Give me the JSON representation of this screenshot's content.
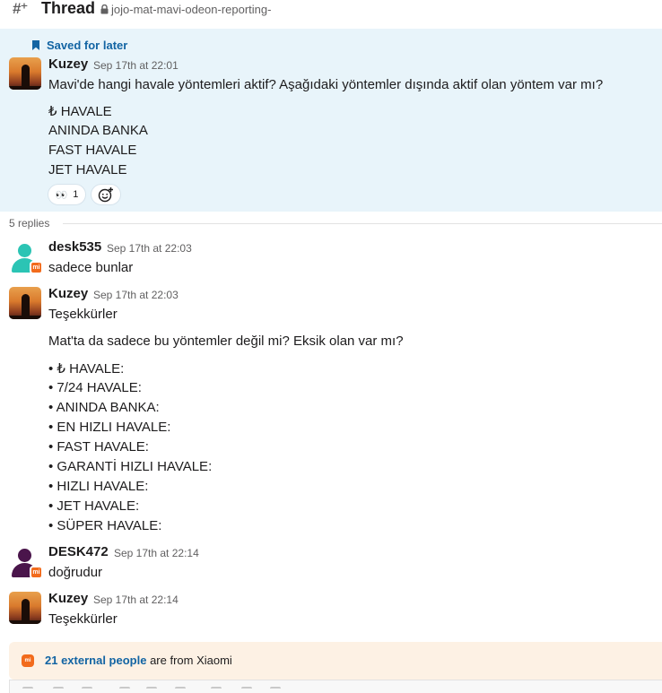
{
  "header": {
    "title": "Thread",
    "channel": "jojo-mat-mavi-odeon-reporting-"
  },
  "parent": {
    "saved_label": "Saved for later",
    "author": "Kuzey",
    "time": "Sep 17th at 22:01",
    "lines": [
      "Mavi'de hangi havale yöntemleri aktif? Aşağıdaki yöntemler dışında aktif olan yöntem var mı?",
      "₺ HAVALE",
      "ANINDA BANKA",
      "FAST HAVALE",
      "JET HAVALE"
    ],
    "reaction": {
      "emoji": "👀",
      "count": "1"
    }
  },
  "replies_label": "5 replies",
  "replies": [
    {
      "author": "desk535",
      "time": "Sep 17th at 22:03",
      "lines": [
        "sadece bunlar"
      ]
    },
    {
      "author": "Kuzey",
      "time": "Sep 17th at 22:03",
      "lines": [
        "Teşekkürler",
        "Mat'ta da sadece bu yöntemler değil mi? Eksik olan var mı?",
        "• ₺ HAVALE:",
        "• 7/24 HAVALE:",
        "• ANINDA BANKA:",
        "• EN HIZLI HAVALE:",
        "• FAST HAVALE:",
        "• GARANTİ HIZLI HAVALE:",
        "• HIZLI HAVALE:",
        "• JET HAVALE:",
        "• SÜPER HAVALE:"
      ]
    },
    {
      "author": "DESK472",
      "time": "Sep 17th at 22:14",
      "lines": [
        "doğrudur"
      ]
    },
    {
      "author": "Kuzey",
      "time": "Sep 17th at 22:14",
      "lines": [
        "Teşekkürler"
      ]
    }
  ],
  "external": {
    "badge": "mi",
    "link_text": "21 external people",
    "rest": " are from Xiaomi"
  },
  "colors": {
    "highlight_bg": "#e8f4fa",
    "link": "#1264a3",
    "xiaomi_orange": "#f26b1c",
    "desk535_avatar": "#2bc4b4",
    "desk472_avatar": "#4a154b",
    "external_bg": "#fdf1e4"
  }
}
